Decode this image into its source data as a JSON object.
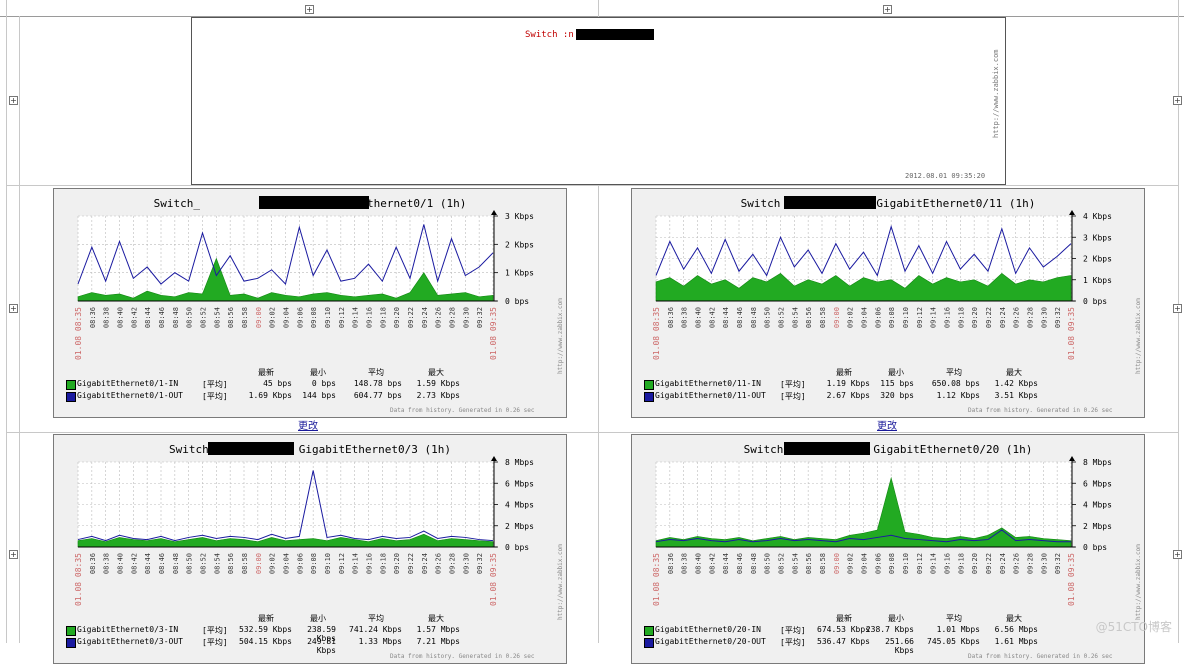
{
  "overview": {
    "title": "Switch :n",
    "url": "http://www.zabbix.com",
    "date": "2012.08.01 09:35:20"
  },
  "links": {
    "change": "更改"
  },
  "legend_headers": {
    "latest": "最新",
    "min": "最小",
    "avg": "平均",
    "max": "最大"
  },
  "generated_text": "Data from history. Generated in 0.26 sec",
  "zabbix_url": "http://www.zabbix.com",
  "watermark": "@51CTO博客",
  "colors": {
    "in": "#22aa22",
    "out": "#1a1aa0",
    "grid": "#bbbbbb",
    "date": "#cc6666"
  },
  "chart_data": [
    {
      "type": "area",
      "title_prefix": "Switch_",
      "title_suffix": "GigabitEthernet0/1  (1h)",
      "x": [
        "08:35",
        "08:36",
        "08:38",
        "08:40",
        "08:42",
        "08:44",
        "08:46",
        "08:48",
        "08:50",
        "08:52",
        "08:54",
        "08:56",
        "08:58",
        "09:00",
        "09:02",
        "09:04",
        "09:06",
        "09:08",
        "09:10",
        "09:12",
        "09:14",
        "09:16",
        "09:18",
        "09:20",
        "09:22",
        "09:24",
        "09:26",
        "09:28",
        "09:30",
        "09:32",
        "09:35"
      ],
      "x_date_left": "01.08 08:35",
      "x_date_mid": "09:00",
      "x_date_right": "01.08 09:35",
      "y_ticks": [
        "0 bps",
        "1 Kbps",
        "2 Kbps",
        "3 Kbps"
      ],
      "ylim": [
        0,
        3
      ],
      "unit": "Kbps",
      "series": [
        {
          "name": "GigabitEthernet0/1-IN",
          "agg": "[平均]",
          "latest": "45 bps",
          "min": "0 bps",
          "avg": "148.78 bps",
          "max": "1.59 Kbps",
          "values": [
            0.15,
            0.3,
            0.2,
            0.25,
            0.1,
            0.35,
            0.2,
            0.15,
            0.3,
            0.25,
            1.5,
            0.2,
            0.25,
            0.1,
            0.3,
            0.2,
            0.15,
            0.25,
            0.3,
            0.2,
            0.15,
            0.2,
            0.25,
            0.1,
            0.3,
            1.0,
            0.2,
            0.25,
            0.3,
            0.15,
            0.2
          ]
        },
        {
          "name": "GigabitEthernet0/1-OUT",
          "agg": "[平均]",
          "latest": "1.69 Kbps",
          "min": "144 bps",
          "avg": "604.77 bps",
          "max": "2.73 Kbps",
          "values": [
            0.6,
            1.9,
            0.7,
            2.1,
            0.8,
            1.2,
            0.6,
            1.0,
            0.7,
            2.4,
            0.9,
            1.6,
            0.7,
            0.8,
            1.1,
            0.6,
            2.6,
            0.9,
            1.8,
            0.7,
            0.8,
            1.3,
            0.7,
            1.9,
            0.8,
            2.7,
            0.7,
            2.2,
            0.9,
            1.2,
            1.7
          ]
        }
      ]
    },
    {
      "type": "area",
      "title_prefix": "Switch",
      "title_suffix": "GigabitEthernet0/11  (1h)",
      "x": [
        "08:35",
        "08:36",
        "08:38",
        "08:40",
        "08:42",
        "08:44",
        "08:46",
        "08:48",
        "08:50",
        "08:52",
        "08:54",
        "08:56",
        "08:58",
        "09:00",
        "09:02",
        "09:04",
        "09:06",
        "09:08",
        "09:10",
        "09:12",
        "09:14",
        "09:16",
        "09:18",
        "09:20",
        "09:22",
        "09:24",
        "09:26",
        "09:28",
        "09:30",
        "09:32",
        "09:35"
      ],
      "x_date_left": "01.08 08:35",
      "x_date_mid": "09:00",
      "x_date_right": "01.08 09:35",
      "y_ticks": [
        "0 bps",
        "1 Kbps",
        "2 Kbps",
        "3 Kbps",
        "4 Kbps"
      ],
      "ylim": [
        0,
        4
      ],
      "unit": "Kbps",
      "series": [
        {
          "name": "GigabitEthernet0/11-IN",
          "agg": "[平均]",
          "latest": "1.19 Kbps",
          "min": "115 bps",
          "avg": "650.08 bps",
          "max": "1.42 Kbps",
          "values": [
            0.9,
            1.1,
            0.7,
            1.2,
            0.8,
            1.0,
            0.6,
            1.1,
            0.9,
            1.3,
            0.7,
            1.0,
            0.8,
            1.2,
            0.7,
            1.1,
            0.9,
            1.0,
            0.6,
            1.2,
            0.8,
            1.1,
            0.9,
            1.0,
            0.7,
            1.3,
            0.8,
            1.0,
            0.9,
            1.1,
            1.2
          ]
        },
        {
          "name": "GigabitEthernet0/11-OUT",
          "agg": "[平均]",
          "latest": "2.67 Kbps",
          "min": "320 bps",
          "avg": "1.12 Kbps",
          "max": "3.51 Kbps",
          "values": [
            1.2,
            2.8,
            1.5,
            2.5,
            1.3,
            2.9,
            1.4,
            2.2,
            1.2,
            3.0,
            1.6,
            2.4,
            1.3,
            2.7,
            1.5,
            2.3,
            1.2,
            3.5,
            1.4,
            2.6,
            1.3,
            2.8,
            1.5,
            2.2,
            1.4,
            3.4,
            1.3,
            2.5,
            1.6,
            2.1,
            2.7
          ]
        }
      ]
    },
    {
      "type": "area",
      "title_prefix": "Switch",
      "title_suffix": "GigabitEthernet0/3  (1h)",
      "x": [
        "08:35",
        "08:36",
        "08:38",
        "08:40",
        "08:42",
        "08:44",
        "08:46",
        "08:48",
        "08:50",
        "08:52",
        "08:54",
        "08:56",
        "08:58",
        "09:00",
        "09:02",
        "09:04",
        "09:06",
        "09:08",
        "09:10",
        "09:12",
        "09:14",
        "09:16",
        "09:18",
        "09:20",
        "09:22",
        "09:24",
        "09:26",
        "09:28",
        "09:30",
        "09:32",
        "09:35"
      ],
      "x_date_left": "01.08 08:35",
      "x_date_mid": "09:00",
      "x_date_right": "01.08 09:35",
      "y_ticks": [
        "0 bps",
        "2 Mbps",
        "4 Mbps",
        "6 Mbps",
        "8 Mbps"
      ],
      "ylim": [
        0,
        8
      ],
      "unit": "Mbps",
      "series": [
        {
          "name": "GigabitEthernet0/3-IN",
          "agg": "[平均]",
          "latest": "532.59 Kbps",
          "min": "238.59 Kbps",
          "avg": "741.24 Kbps",
          "max": "1.57 Mbps",
          "values": [
            0.6,
            0.8,
            0.5,
            0.9,
            0.7,
            0.6,
            0.8,
            0.5,
            0.7,
            0.9,
            0.6,
            0.8,
            0.7,
            0.5,
            0.9,
            0.6,
            0.7,
            0.8,
            0.6,
            0.9,
            0.7,
            0.5,
            0.8,
            0.6,
            0.7,
            1.2,
            0.6,
            0.8,
            0.7,
            0.6,
            0.5
          ]
        },
        {
          "name": "GigabitEthernet0/3-OUT",
          "agg": "[平均]",
          "latest": "504.15 Kbps",
          "min": "249.81 Kbps",
          "avg": "1.33 Mbps",
          "max": "7.21 Mbps",
          "values": [
            0.7,
            1.0,
            0.6,
            1.1,
            0.8,
            0.7,
            1.0,
            0.6,
            0.9,
            1.1,
            0.8,
            1.0,
            0.9,
            0.7,
            1.2,
            0.8,
            1.0,
            7.2,
            0.9,
            1.1,
            0.8,
            0.7,
            1.0,
            0.8,
            0.9,
            1.5,
            0.8,
            1.0,
            0.9,
            0.7,
            0.6
          ]
        }
      ]
    },
    {
      "type": "area",
      "title_prefix": "Switch",
      "title_suffix": "GigabitEthernet0/20  (1h)",
      "x": [
        "08:35",
        "08:36",
        "08:38",
        "08:40",
        "08:42",
        "08:44",
        "08:46",
        "08:48",
        "08:50",
        "08:52",
        "08:54",
        "08:56",
        "08:58",
        "09:00",
        "09:02",
        "09:04",
        "09:06",
        "09:08",
        "09:10",
        "09:12",
        "09:14",
        "09:16",
        "09:18",
        "09:20",
        "09:22",
        "09:24",
        "09:26",
        "09:28",
        "09:30",
        "09:32",
        "09:35"
      ],
      "x_date_left": "01.08 08:35",
      "x_date_mid": "09:00",
      "x_date_right": "01.08 09:35",
      "y_ticks": [
        "0 bps",
        "2 Mbps",
        "4 Mbps",
        "6 Mbps",
        "8 Mbps"
      ],
      "ylim": [
        0,
        8
      ],
      "unit": "Mbps",
      "series": [
        {
          "name": "GigabitEthernet0/20-IN",
          "agg": "[平均]",
          "latest": "674.53 Kbps",
          "min": "238.7 Kbps",
          "avg": "1.01 Mbps",
          "max": "6.56 Mbps",
          "values": [
            0.6,
            0.9,
            0.7,
            1.0,
            0.8,
            0.7,
            0.9,
            0.6,
            0.8,
            1.0,
            0.7,
            0.9,
            0.8,
            0.7,
            1.1,
            1.3,
            1.6,
            6.5,
            1.4,
            1.2,
            0.9,
            0.8,
            1.0,
            0.8,
            1.1,
            1.8,
            0.9,
            1.0,
            0.8,
            0.7,
            0.6
          ]
        },
        {
          "name": "GigabitEthernet0/20-OUT",
          "agg": "[平均]",
          "latest": "536.47 Kbps",
          "min": "251.66 Kbps",
          "avg": "745.05 Kbps",
          "max": "1.61 Mbps",
          "values": [
            0.5,
            0.7,
            0.6,
            0.8,
            0.6,
            0.5,
            0.7,
            0.5,
            0.6,
            0.8,
            0.6,
            0.7,
            0.6,
            0.5,
            0.8,
            0.7,
            0.9,
            1.1,
            0.8,
            0.7,
            0.6,
            0.5,
            0.7,
            0.6,
            0.7,
            1.6,
            0.6,
            0.7,
            0.6,
            0.5,
            0.5
          ]
        }
      ]
    }
  ]
}
